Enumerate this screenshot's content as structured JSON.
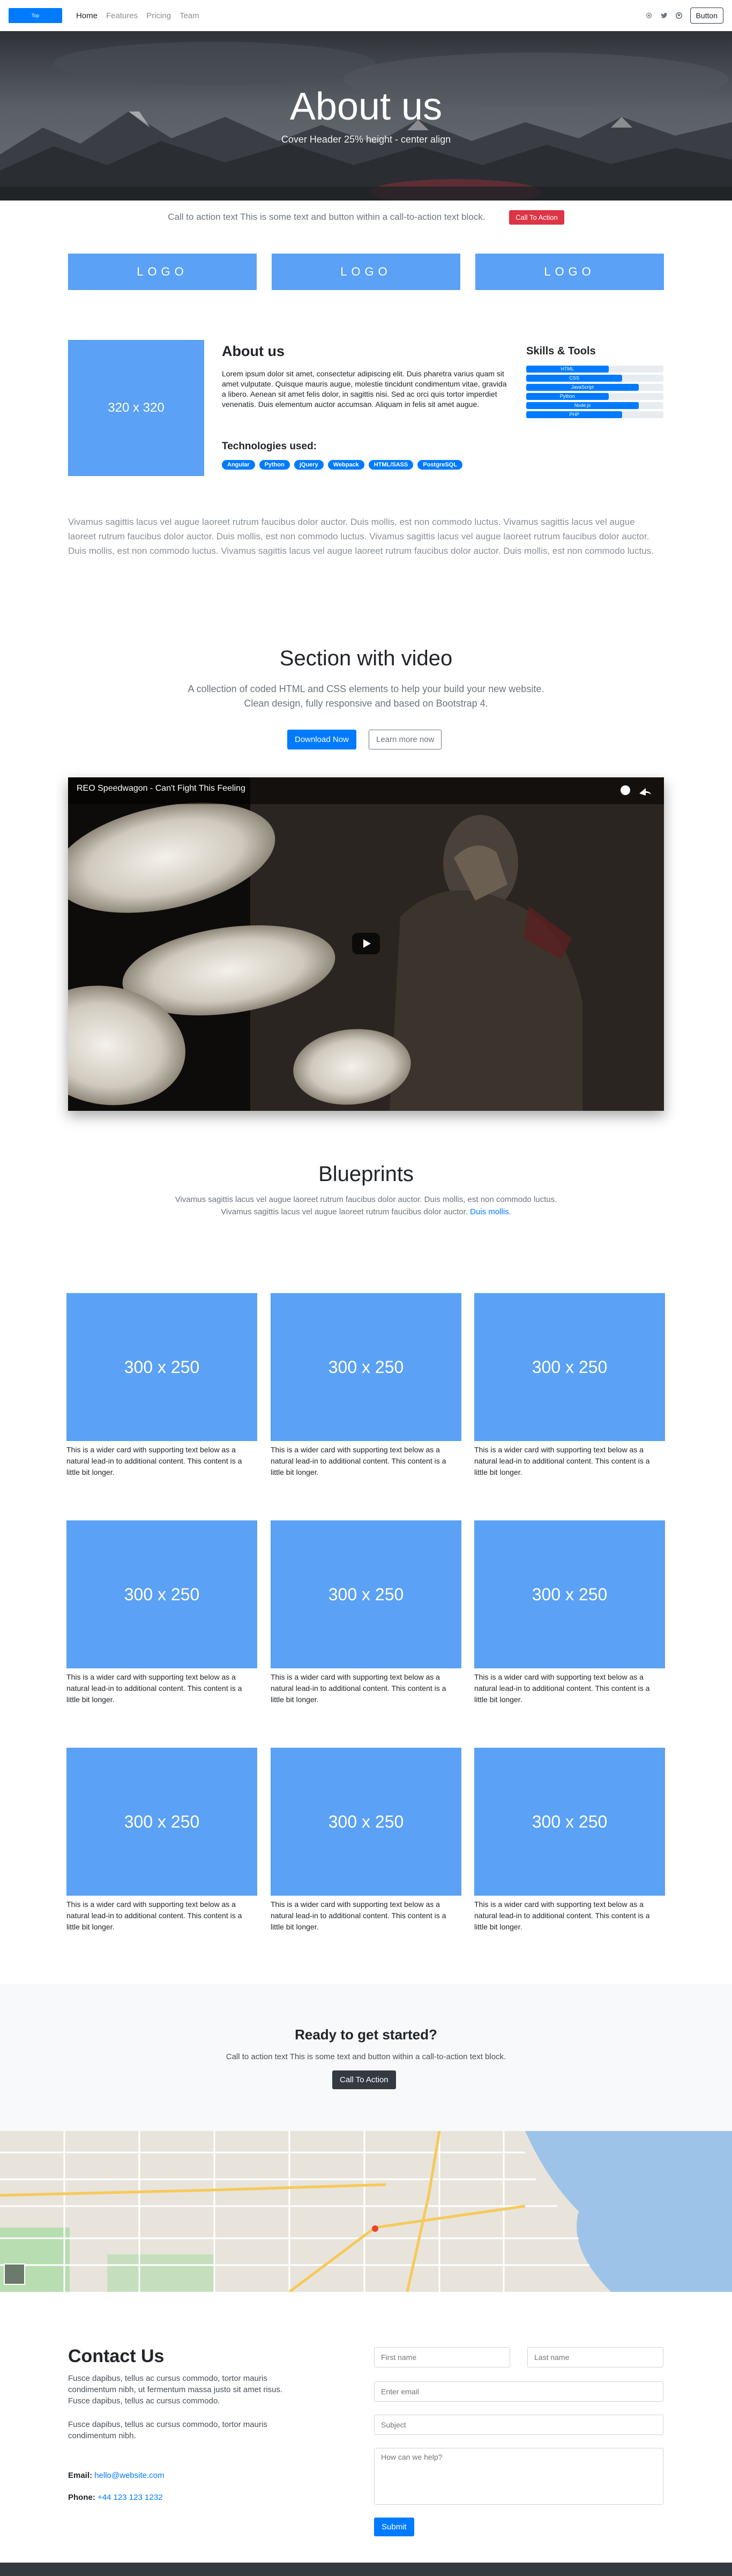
{
  "navbar": {
    "brand": "Top",
    "links": [
      "Home",
      "Features",
      "Pricing",
      "Team"
    ],
    "button": "Button",
    "icons": [
      "gear-icon",
      "twitter-icon",
      "github-icon"
    ]
  },
  "hero": {
    "title": "About us",
    "subtitle": "Cover Header 25% height - center align"
  },
  "cta_strip": {
    "text": "Call to action text This is some text and button within a call-to-action text block.",
    "button": "Call To Action"
  },
  "logos": [
    "LOGO",
    "LOGO",
    "LOGO"
  ],
  "about": {
    "image_label": "320 x 320",
    "title": "About us",
    "text": "Lorem ipsum dolor sit amet, consectetur adipiscing elit. Duis pharetra varius quam sit amet vulputate. Quisque mauris augue, molestie tincidunt condimentum vitae, gravida a libero. Aenean sit amet felis dolor, in sagittis nisi. Sed ac orci quis tortor imperdiet venenatis. Duis elementum auctor accumsan. Aliquam in felis sit amet augue.",
    "tech_title": "Technologies used:",
    "tech": [
      "Angular",
      "Python",
      "jQuery",
      "Webpack",
      "HTML/SASS",
      "PostgreSQL"
    ],
    "skills_title": "Skills & Tools",
    "skills": [
      {
        "name": "HTML",
        "level": 0.6
      },
      {
        "name": "CSS",
        "level": 0.7
      },
      {
        "name": "JavaScript",
        "level": 0.82
      },
      {
        "name": "Python",
        "level": 0.6
      },
      {
        "name": "Node.js",
        "level": 0.82
      },
      {
        "name": "PHP",
        "level": 0.7
      }
    ]
  },
  "lorem_para": "Vivamus sagittis lacus vel augue laoreet rutrum faucibus dolor auctor. Duis mollis, est non commodo luctus. Vivamus sagittis lacus vel augue laoreet rutrum faucibus dolor auctor. Duis mollis, est non commodo luctus. Vivamus sagittis lacus vel augue laoreet rutrum faucibus dolor auctor. Duis mollis, est non commodo luctus. Vivamus sagittis lacus vel augue laoreet rutrum faucibus dolor auctor. Duis mollis, est non commodo luctus.",
  "video_section": {
    "title": "Section with video",
    "sub1": "A collection of coded HTML and CSS elements to help your build your new website.",
    "sub2": "Clean design, fully responsive and based on Bootstrap 4.",
    "btn_primary": "Download Now",
    "btn_secondary": "Learn more now",
    "video_title": "REO Speedwagon - Can't Fight This Feeling"
  },
  "blueprints": {
    "title": "Blueprints",
    "text": "Vivamus sagittis lacus vel augue laoreet rutrum faucibus dolor auctor. Duis mollis, est non commodo luctus. Vivamus sagittis lacus vel augue laoreet rutrum faucibus dolor auctor.",
    "link": "Duis mollis",
    "card_image": "300 x 250",
    "card_text": "This is a wider card with supporting text below as a natural lead-in to additional content. This content is a little bit longer."
  },
  "ready": {
    "title": "Ready to get started?",
    "text": "Call to action text This is some text and button within a call-to-action text block.",
    "button": "Call To Action"
  },
  "contact": {
    "title": "Contact Us",
    "p1": "Fusce dapibus, tellus ac cursus commodo, tortor mauris condimentum nibh, ut fermentum massa justo sit amet risus. Fusce dapibus, tellus ac cursus commodo.",
    "p2": "Fusce dapibus, tellus ac cursus commodo, tortor mauris condimentum nibh.",
    "email_label": "Email:",
    "email": "hello@website.com",
    "phone_label": "Phone:",
    "phone": "+44 123 123 1232",
    "first_name": "First name",
    "last_name": "Last name",
    "email_placeholder": "Enter email",
    "subject": "Subject",
    "message": "How can we help?",
    "submit": "Submit"
  },
  "colors": {
    "primary": "#007bff",
    "placeholder": "#5ba1f5",
    "danger": "#dc3545",
    "dark": "#343a40"
  }
}
